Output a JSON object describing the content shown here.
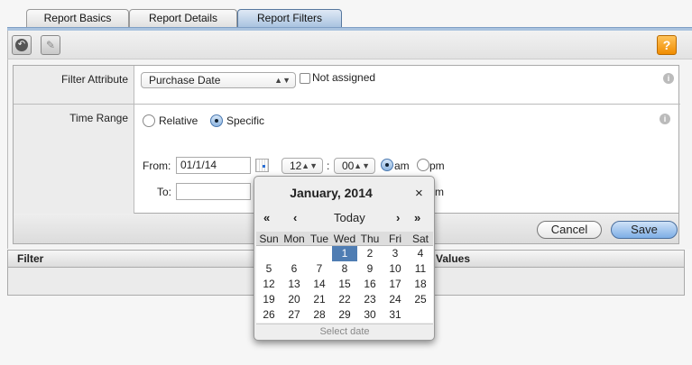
{
  "tabs": [
    {
      "label": "Report Basics"
    },
    {
      "label": "Report Details"
    },
    {
      "label": "Report Filters"
    }
  ],
  "toolbar": {
    "help": "?"
  },
  "form": {
    "filter_attribute": {
      "label": "Filter Attribute",
      "value": "Purchase Date",
      "not_assigned": "Not assigned"
    },
    "time_range": {
      "label": "Time Range",
      "relative": "Relative",
      "specific": "Specific",
      "from_label": "From:",
      "from_value": "01/1/14",
      "from_hour": "12",
      "from_min": "00",
      "am": "am",
      "pm": "pm",
      "colon": ":",
      "to_label": "To:",
      "to_value": "",
      "to_pm_partial": "m"
    }
  },
  "buttons": {
    "cancel": "Cancel",
    "save": "Save"
  },
  "filter_table": {
    "col1": "Filter",
    "col2": "Values"
  },
  "calendar": {
    "title": "January, 2014",
    "close": "×",
    "prev_year": "«",
    "prev": "‹",
    "today": "Today",
    "next": "›",
    "next_year": "»",
    "days": [
      "Sun",
      "Mon",
      "Tue",
      "Wed",
      "Thu",
      "Fri",
      "Sat"
    ],
    "weeks": [
      [
        "",
        "",
        "",
        "1",
        "2",
        "3",
        "4"
      ],
      [
        "5",
        "6",
        "7",
        "8",
        "9",
        "10",
        "11"
      ],
      [
        "12",
        "13",
        "14",
        "15",
        "16",
        "17",
        "18"
      ],
      [
        "19",
        "20",
        "21",
        "22",
        "23",
        "24",
        "25"
      ],
      [
        "26",
        "27",
        "28",
        "29",
        "30",
        "31",
        ""
      ]
    ],
    "selected": "1",
    "footer": "Select date"
  }
}
